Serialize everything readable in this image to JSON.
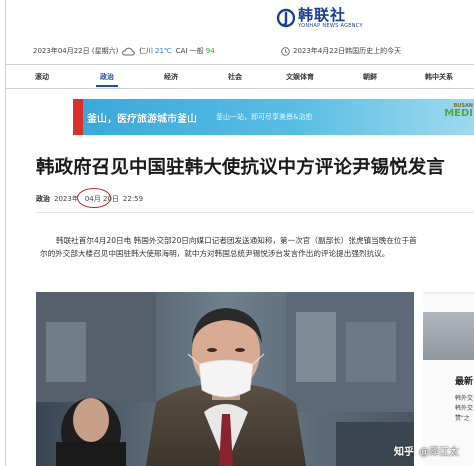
{
  "header": {
    "logo_cn": "韩联社",
    "logo_en": "YONHAP NEWS AGENCY"
  },
  "infobar": {
    "date": "2023年04月22日 (星期六)",
    "weather_icon": "cloud-icon",
    "city": "仁川",
    "temp": "21℃",
    "air_label": "CAI 一般",
    "air_value": "94",
    "history_icon": "clock-icon",
    "history": "2023年4月22日韩国历史上的今天"
  },
  "nav": {
    "items": [
      "滚动",
      "政治",
      "经济",
      "社会",
      "文娱体育",
      "朝鲜",
      "韩中关系"
    ],
    "active": "政治"
  },
  "banner": {
    "text": "釜山，医疗旅游城市釜山",
    "sub": "釜山一站，即可尽享美景&治愈",
    "brand_top": "BUSAN",
    "brand_main": "MEDI"
  },
  "article": {
    "headline": "韩政府召见中国驻韩大使抗议中方评论尹锡悦发言",
    "section": "政治",
    "date_year": "2023年",
    "date_month": "04月",
    "date_day": "20日",
    "time": "22:59",
    "body": "韩联社首尔4月20日电 韩国外交部20日向媒口记者团发送通知称，第一次官（副部长）张虎镇当晚在位于首尔的外交部大楼召见中国驻韩大使邢海明，就中方对韩国总统尹锡悦涉台发言作出的评论提出强烈抗议。"
  },
  "sidebar": {
    "title": "最新",
    "line1": "韩外交",
    "line2": "韩外交",
    "line3": "赞\"之"
  },
  "watermark": {
    "site": "知乎",
    "author": "@泽江太"
  },
  "colors": {
    "brand_blue": "#1d4fa0",
    "circle_red": "#b22a2a",
    "banner_blue": "#37a8dc"
  }
}
